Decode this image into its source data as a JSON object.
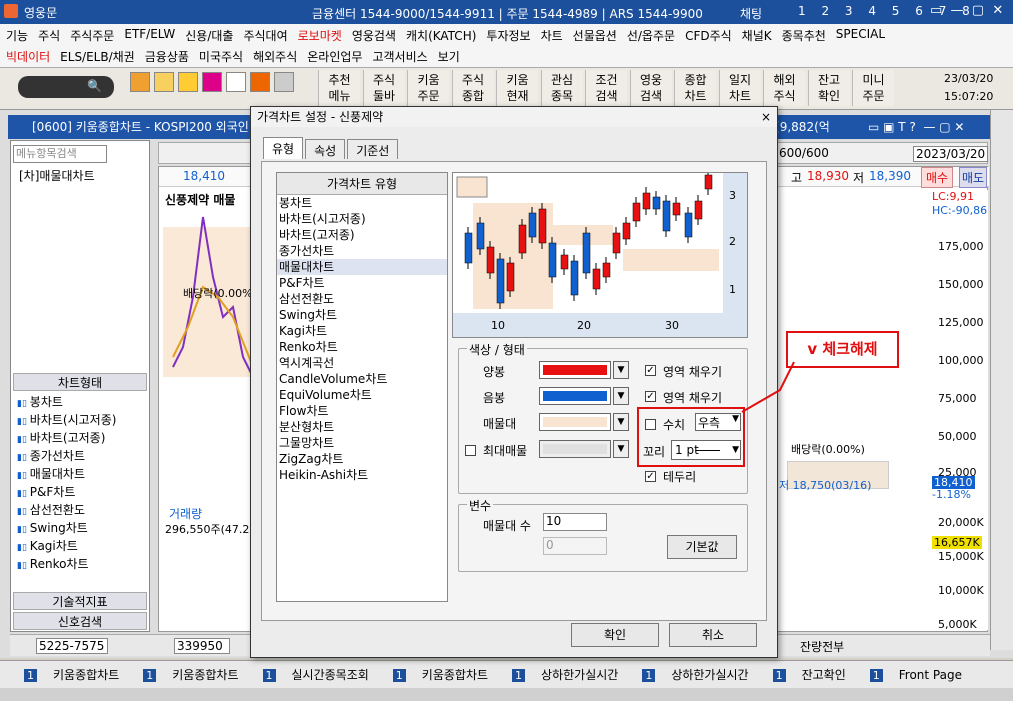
{
  "titlebar": {
    "app_name": "영웅문",
    "center_text": "금융센터 1544-9000/1544-9911 | 주문 1544-4989 | ARS 1544-9900",
    "chat": "채팅",
    "tab_numbers": "1 2 3 4 5 6 7 8"
  },
  "menu": {
    "row1": [
      "기능",
      "주식",
      "주식주문",
      "ETF/ELW",
      "신용/대출",
      "주식대여",
      "로보마켓",
      "영웅검색",
      "캐치(KATCH)",
      "투자정보",
      "차트",
      "선물옵션",
      "선/옵주문",
      "CFD주식",
      "채널K",
      "종목추천",
      "SPECIAL"
    ],
    "row2": [
      "빅데이터",
      "ELS/ELB/채권",
      "금융상품",
      "미국주식",
      "해외주식",
      "온라인업무",
      "고객서비스",
      "보기"
    ]
  },
  "toolbar": {
    "buttons": [
      "추천 메뉴",
      "주식 둘바",
      "키움 주문",
      "주식 종합",
      "키움 현재",
      "관심 종목",
      "조건 검색",
      "영웅 검색",
      "종합 차트",
      "일지 차트",
      "해외 주식",
      "잔고 확인",
      "미니 주문"
    ],
    "date": "23/03/20",
    "time": "15:07:20"
  },
  "chart_window": {
    "title": "[0600] 키움종합차트 - KOSPI200 외국인",
    "title_right": "액[9,882(억",
    "search_placeholder": "메뉴항목검색",
    "selected_menu": "[차]매물대차트",
    "stock_name": "신풍제약 매물",
    "price": "18,410",
    "high_label": "고",
    "high": "18,930",
    "low_label": "저",
    "low": "18,390",
    "buy": "매수",
    "sell": "매도",
    "count": "600/600",
    "chart_date": "2023/03/20",
    "lc": "LC:9,91",
    "hc": "HC:-90,86",
    "axis": [
      "175,000",
      "150,000",
      "125,000",
      "100,000",
      "75,000",
      "50,000",
      "25,000",
      "20,000K",
      "15,000K",
      "10,000K",
      "5,000K"
    ],
    "current_price": "18,410",
    "change": "-1.18%",
    "volume_mark": "16,657K",
    "dividend": "배당락(0.00%)",
    "low_note": "저 18,750(03/16)",
    "volume_label": "거래량",
    "volume": "296,550주(47.25",
    "left_section_title": "차트형태",
    "left_items": [
      "봉차트",
      "바차트(시고저종)",
      "바차트(고저종)",
      "종가선차트",
      "매물대차트",
      "P&F차트",
      "삼선전환도",
      "Swing차트",
      "Kagi차트",
      "Renko차트"
    ],
    "left_footer1": "기술적지표",
    "left_footer2": "신호검색",
    "bottom_code": "5225-7575",
    "bottom_num": "339950",
    "bottom_right": "잔량전부"
  },
  "dialog": {
    "title": "가격차트 설정 - 신풍제약",
    "close": "×",
    "tabs": [
      "유형",
      "속성",
      "기준선"
    ],
    "list_header": "가격차트 유형",
    "types": [
      "봉차트",
      "바차트(시고저종)",
      "바차트(고저종)",
      "종가선차트",
      "매물대차트",
      "P&F차트",
      "삼선전환도",
      "Swing차트",
      "Kagi차트",
      "Renko차트",
      "역시계곡선",
      "CandleVolume차트",
      "EquiVolume차트",
      "Flow차트",
      "분산형차트",
      "그물망차트",
      "ZigZag차트",
      "Heikin-Ashi차트"
    ],
    "selected_type": "매물대차트",
    "preview_x": [
      "10",
      "20",
      "30"
    ],
    "preview_y": [
      "3",
      "2",
      "1"
    ],
    "color_group": "색상 / 형태",
    "rise_label": "양봉",
    "fall_label": "음봉",
    "band_label": "매물대",
    "max_band_label": "최대매물",
    "fill_label": "영역 채우기",
    "value_label": "수치",
    "value_select": "우측",
    "tail_label": "꼬리",
    "tail_select": "1 pt",
    "border_label": "테두리",
    "var_group": "변수",
    "band_count_label": "매물대 수",
    "band_count": "10",
    "band_count2": "0",
    "default_btn": "기본값",
    "ok_btn": "확인",
    "cancel_btn": "취소",
    "colors": {
      "rise": "#e81010",
      "fall": "#1060d0",
      "band": "#f8e4d0",
      "max_band": "#e0e0e0"
    }
  },
  "annotation": {
    "callout": "v 체크해제"
  },
  "taskbar": {
    "items": [
      "키움종합차트",
      "키움종합차트",
      "실시간종목조회",
      "키움종합차트",
      "상하한가실시간",
      "상하한가실시간",
      "잔고확인",
      "Front Page"
    ]
  }
}
